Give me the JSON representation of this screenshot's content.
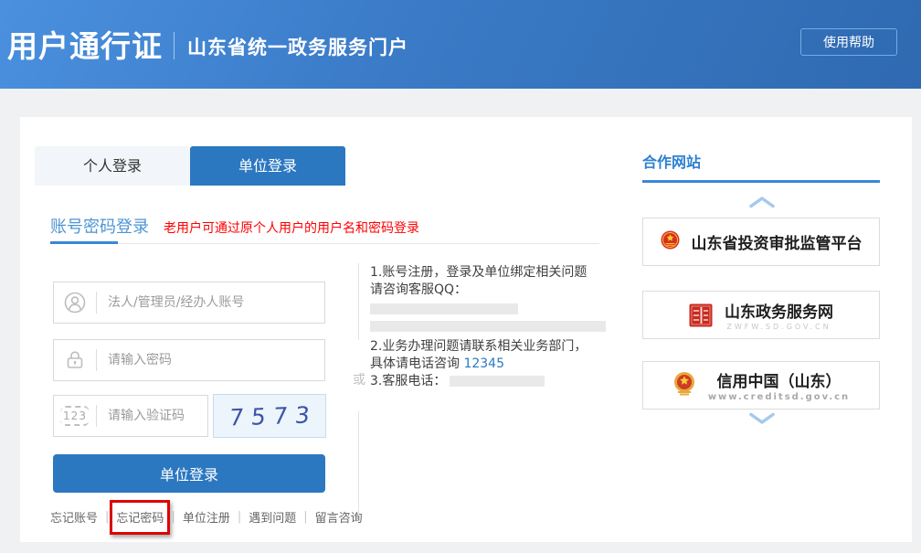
{
  "header": {
    "brand_title": "用户通行证",
    "brand_subtitle": "山东省统一政务服务门户",
    "help_button": "使用帮助"
  },
  "login": {
    "tabs": [
      {
        "label": "个人登录",
        "active": false
      },
      {
        "label": "单位登录",
        "active": true
      }
    ],
    "section_title": "账号密码登录",
    "section_note": "老用户可通过原个人用户的用户名和密码登录",
    "account_placeholder": "法人/管理员/经办人账号",
    "password_placeholder": "请输入密码",
    "captcha_placeholder": "请输入验证码",
    "captcha_icon_label": "123",
    "captcha_value": "7573",
    "submit_label": "单位登录",
    "links": [
      "忘记账号",
      "忘记密码",
      "单位注册",
      "遇到问题",
      "留言咨询"
    ],
    "highlighted_link": "忘记密码",
    "link_separator": "|"
  },
  "divider": {
    "or_label": "或"
  },
  "help_info": {
    "line1": "1.账号注册，登录及单位绑定相关问题",
    "line2": "请咨询客服QQ：",
    "line3": "2.业务办理问题请联系相关业务部门，",
    "line4": "具体请电话咨询 ",
    "phone": "12345",
    "line5": "3.客服电话："
  },
  "partners": {
    "title": "合作网站",
    "items": [
      {
        "name": "山东省投资审批监管平台",
        "url": ""
      },
      {
        "name": "山东政务服务网",
        "url": "ZWFW.SD.GOV.CN"
      },
      {
        "name": "信用中国（山东）",
        "url": "www.creditsd.gov.cn"
      }
    ]
  },
  "colors": {
    "accent_blue": "#2b78c0",
    "header_gradient_start": "#4a90de",
    "header_gradient_end": "#2f6ab1",
    "section_title_blue": "#4e94d4",
    "note_red": "#ff0000",
    "highlight_box_red": "#dd0404",
    "captcha_digit_blue": "#3c55a6",
    "partners_title_blue": "#2f80d0"
  }
}
